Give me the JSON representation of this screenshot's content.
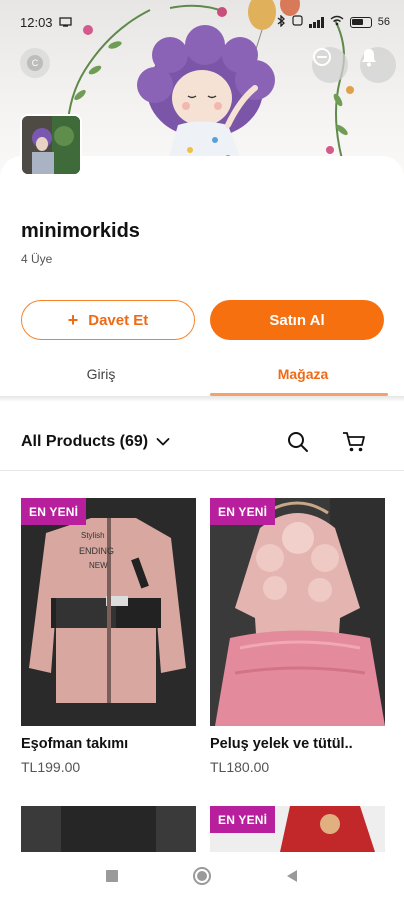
{
  "status_bar": {
    "time": "12:03",
    "battery": "56"
  },
  "header": {
    "site_name": "minimorkids",
    "members": "4 Üye",
    "avatar_letter": "C"
  },
  "actions": {
    "invite_label": "Davet Et",
    "buy_label": "Satın Al"
  },
  "tabs": [
    {
      "label": "Giriş",
      "active": false
    },
    {
      "label": "Mağaza",
      "active": true
    }
  ],
  "toolbar": {
    "filter_label": "All Products (69)"
  },
  "products": [
    {
      "badge": "EN YENİ",
      "name": "Eşofman takımı",
      "price": "TL199.00"
    },
    {
      "badge": "EN YENİ",
      "name": "Peluş yelek ve tütül..",
      "price": "TL180.00"
    },
    {
      "badge": "",
      "name": "",
      "price": ""
    },
    {
      "badge": "EN YENİ",
      "name": "",
      "price": ""
    }
  ],
  "colors": {
    "accent": "#f6700f",
    "badge": "#b81f9c"
  }
}
